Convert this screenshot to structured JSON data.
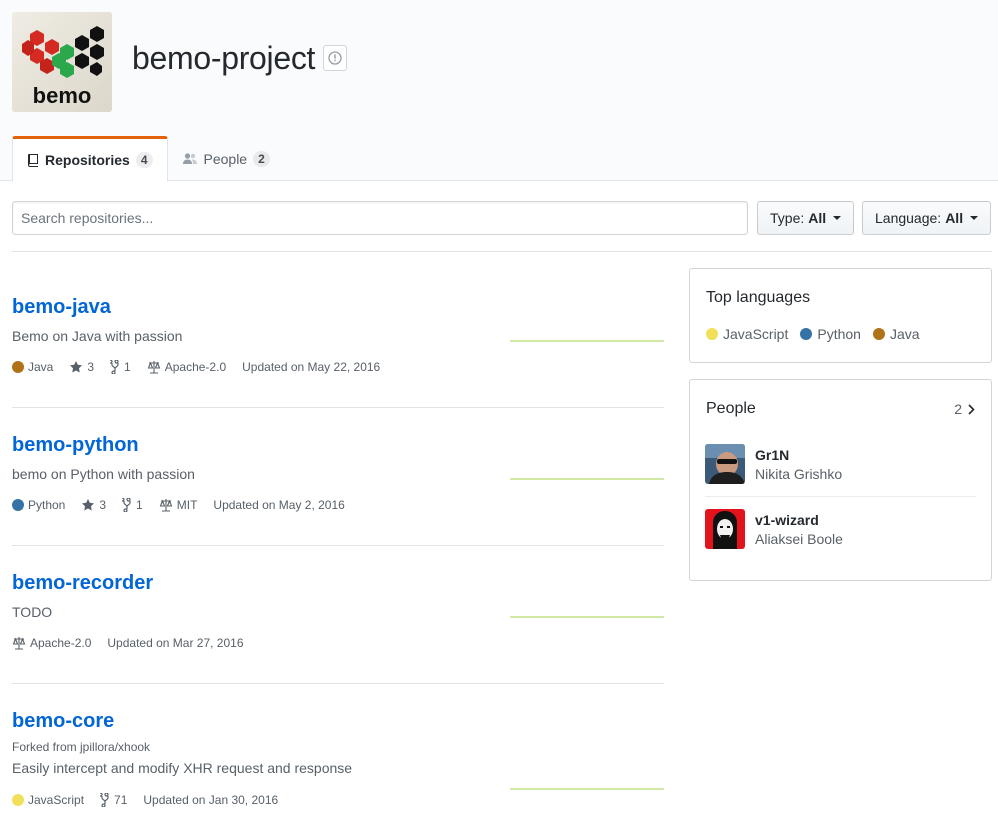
{
  "org": {
    "name": "bemo-project",
    "logo_text": "bemo"
  },
  "tabs": [
    {
      "label": "Repositories",
      "count": "4"
    },
    {
      "label": "People",
      "count": "2"
    }
  ],
  "filters": {
    "search_placeholder": "Search repositories...",
    "type_label": "Type:",
    "type_value": "All",
    "language_label": "Language:",
    "language_value": "All"
  },
  "repos": [
    {
      "name": "bemo-java",
      "forked_from": "",
      "description": "Bemo on Java with passion",
      "language": "Java",
      "language_color": "#b07219",
      "stars": "3",
      "forks": "1",
      "license": "Apache-2.0",
      "updated": "Updated on May 22, 2016"
    },
    {
      "name": "bemo-python",
      "forked_from": "",
      "description": "bemo on Python with passion",
      "language": "Python",
      "language_color": "#3572A5",
      "stars": "3",
      "forks": "1",
      "license": "MIT",
      "updated": "Updated on May 2, 2016"
    },
    {
      "name": "bemo-recorder",
      "forked_from": "",
      "description": "TODO",
      "language": "",
      "license": "Apache-2.0",
      "updated": "Updated on Mar 27, 2016"
    },
    {
      "name": "bemo-core",
      "forked_from": "Forked from jpillora/xhook",
      "description": "Easily intercept and modify XHR request and response",
      "language": "JavaScript",
      "language_color": "#f1e05a",
      "forks": "71",
      "updated": "Updated on Jan 30, 2016"
    }
  ],
  "top_languages": {
    "title": "Top languages",
    "items": [
      {
        "name": "JavaScript",
        "color": "#f1e05a"
      },
      {
        "name": "Python",
        "color": "#3572A5"
      },
      {
        "name": "Java",
        "color": "#b07219"
      }
    ]
  },
  "people": {
    "title": "People",
    "count": "2",
    "members": [
      {
        "login": "Gr1N",
        "name": "Nikita Grishko"
      },
      {
        "login": "v1-wizard",
        "name": "Aliaksei Boole"
      }
    ]
  },
  "colors": {
    "link": "#0366d6",
    "tab_accent": "#e36209",
    "sparkline": "#c6e48b"
  }
}
